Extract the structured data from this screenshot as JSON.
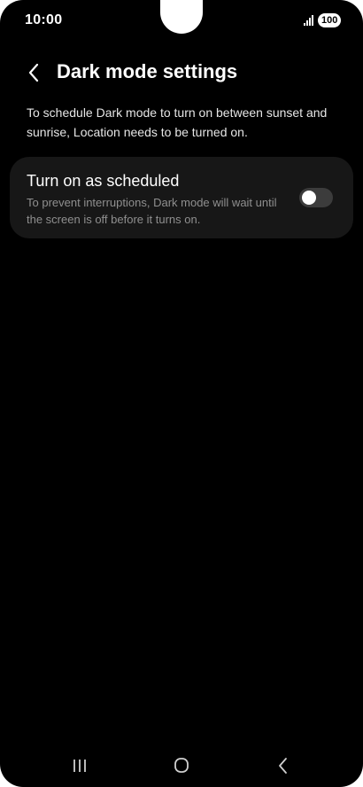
{
  "status_bar": {
    "time": "10:00",
    "battery": "100",
    "icons": [
      "signal-icon",
      "battery-icon"
    ]
  },
  "header": {
    "back_icon": "chevron-left-icon",
    "title": "Dark mode settings"
  },
  "description": "To schedule Dark mode to turn on between sunset and sunrise, Location needs to be turned on.",
  "setting": {
    "title": "Turn on as scheduled",
    "subtitle": "To prevent interruptions, Dark mode will wait until the screen is off before it turns on.",
    "toggle_on": false
  },
  "nav_bar": {
    "icons": [
      "recents-icon",
      "home-icon",
      "back-icon"
    ]
  },
  "colors": {
    "background": "#000000",
    "card": "#171717",
    "text_primary": "#ffffff",
    "text_secondary": "#8f8f8f",
    "toggle_track_off": "#3c3c3c"
  }
}
